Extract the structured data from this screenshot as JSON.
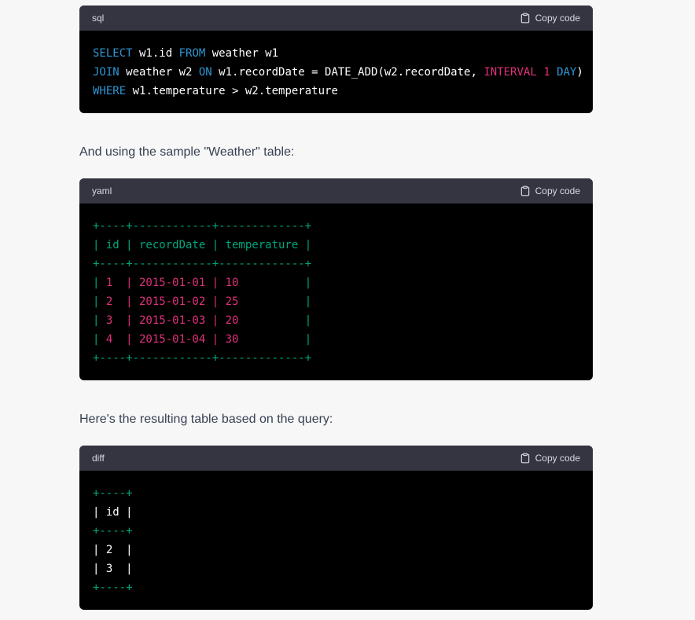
{
  "blocks": [
    {
      "language": "sql",
      "copy_label": "Copy code",
      "lines": [
        [
          {
            "t": "kw",
            "v": "SELECT"
          },
          {
            "t": "fn",
            "v": " w1.id "
          },
          {
            "t": "kw",
            "v": "FROM"
          },
          {
            "t": "fn",
            "v": " weather w1"
          }
        ],
        [
          {
            "t": "kw",
            "v": "JOIN"
          },
          {
            "t": "fn",
            "v": " weather w2 "
          },
          {
            "t": "kw",
            "v": "ON"
          },
          {
            "t": "fn",
            "v": " w1.recordDate = DATE_ADD(w2.recordDate, "
          },
          {
            "t": "num",
            "v": "INTERVAL"
          },
          {
            "t": "fn",
            "v": " "
          },
          {
            "t": "num",
            "v": "1"
          },
          {
            "t": "fn",
            "v": " "
          },
          {
            "t": "kw",
            "v": "DAY"
          },
          {
            "t": "fn",
            "v": ")"
          }
        ],
        [
          {
            "t": "kw",
            "v": "WHERE"
          },
          {
            "t": "fn",
            "v": " w1.temperature > w2.temperature"
          }
        ]
      ]
    },
    {
      "language": "yaml",
      "copy_label": "Copy code",
      "lines": [
        [
          {
            "t": "border",
            "v": "+----+------------+-------------+"
          }
        ],
        [
          {
            "t": "border",
            "v": "| id | recordDate | temperature |"
          }
        ],
        [
          {
            "t": "border",
            "v": "+----+------------+-------------+"
          }
        ],
        [
          {
            "t": "border",
            "v": "| "
          },
          {
            "t": "cell",
            "v": "1  | 2015-01-01 | 10"
          },
          {
            "t": "border",
            "v": "          |"
          }
        ],
        [
          {
            "t": "border",
            "v": "| "
          },
          {
            "t": "cell",
            "v": "2  | 2015-01-02 | 25"
          },
          {
            "t": "border",
            "v": "          |"
          }
        ],
        [
          {
            "t": "border",
            "v": "| "
          },
          {
            "t": "cell",
            "v": "3  | 2015-01-03 | 20"
          },
          {
            "t": "border",
            "v": "          |"
          }
        ],
        [
          {
            "t": "border",
            "v": "| "
          },
          {
            "t": "cell",
            "v": "4  | 2015-01-04 | 30"
          },
          {
            "t": "border",
            "v": "          |"
          }
        ],
        [
          {
            "t": "border",
            "v": "+----+------------+-------------+"
          }
        ]
      ]
    },
    {
      "language": "diff",
      "copy_label": "Copy code",
      "lines": [
        [
          {
            "t": "border",
            "v": "+----+"
          }
        ],
        [
          {
            "t": "fn",
            "v": "| id |"
          }
        ],
        [
          {
            "t": "border",
            "v": "+----+"
          }
        ],
        [
          {
            "t": "fn",
            "v": "| 2  |"
          }
        ],
        [
          {
            "t": "fn",
            "v": "| 3  |"
          }
        ],
        [
          {
            "t": "border",
            "v": "+----+"
          }
        ]
      ]
    }
  ],
  "prose": {
    "intro_sample": "And using the sample \"Weather\" table:",
    "intro_result": "Here's the resulting table based on the query:"
  },
  "colors": {
    "keyword": "#2e95d3",
    "number": "#df3079",
    "border": "#00a67d",
    "header_bg": "#343541",
    "code_bg": "#000000"
  },
  "icons": {
    "copy": "clipboard-icon"
  }
}
